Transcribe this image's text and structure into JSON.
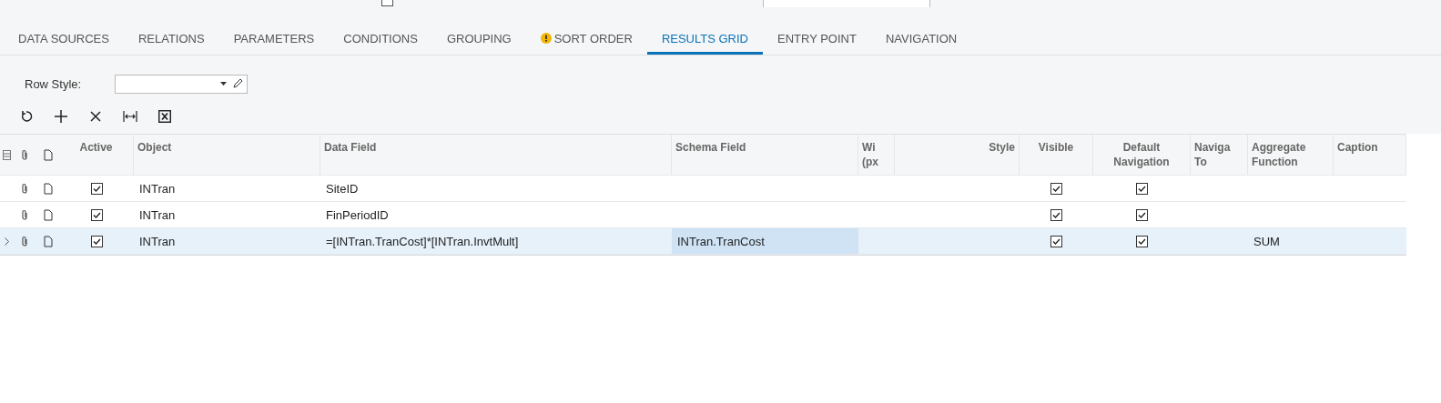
{
  "top_bar": {
    "mobile_checkbox": {
      "checked": false
    }
  },
  "tabs": [
    {
      "label": "DATA SOURCES",
      "selected": false,
      "warning": false
    },
    {
      "label": "RELATIONS",
      "selected": false,
      "warning": false
    },
    {
      "label": "PARAMETERS",
      "selected": false,
      "warning": false
    },
    {
      "label": "CONDITIONS",
      "selected": false,
      "warning": false
    },
    {
      "label": "GROUPING",
      "selected": false,
      "warning": false
    },
    {
      "label": "SORT ORDER",
      "selected": false,
      "warning": true
    },
    {
      "label": "RESULTS GRID",
      "selected": true,
      "warning": false
    },
    {
      "label": "ENTRY POINT",
      "selected": false,
      "warning": false
    },
    {
      "label": "NAVIGATION",
      "selected": false,
      "warning": false
    }
  ],
  "row_style": {
    "label": "Row Style:"
  },
  "toolbar": [
    {
      "kind": "refresh"
    },
    {
      "kind": "add"
    },
    {
      "kind": "delete"
    },
    {
      "kind": "fit"
    },
    {
      "kind": "excel"
    }
  ],
  "table": {
    "columns": [
      "Active",
      "Object",
      "Data Field",
      "Schema Field",
      "Wi (px",
      "Style",
      "Visible",
      "Default Navigation",
      "Naviga To",
      "Aggregate Function",
      "Caption"
    ],
    "rows": [
      {
        "selected": false,
        "active": true,
        "object": "INTran",
        "data_field": "SiteID",
        "visible": true,
        "default_navigation": true
      },
      {
        "selected": false,
        "active": true,
        "object": "INTran",
        "data_field": "FinPeriodID",
        "visible": true,
        "default_navigation": true
      },
      {
        "selected": true,
        "active": true,
        "object": "INTran",
        "data_field": "=[INTran.TranCost]*[INTran.InvtMult]",
        "schema_field": "INTran.TranCost",
        "visible": true,
        "default_navigation": true,
        "aggregate_function": "SUM"
      }
    ]
  }
}
